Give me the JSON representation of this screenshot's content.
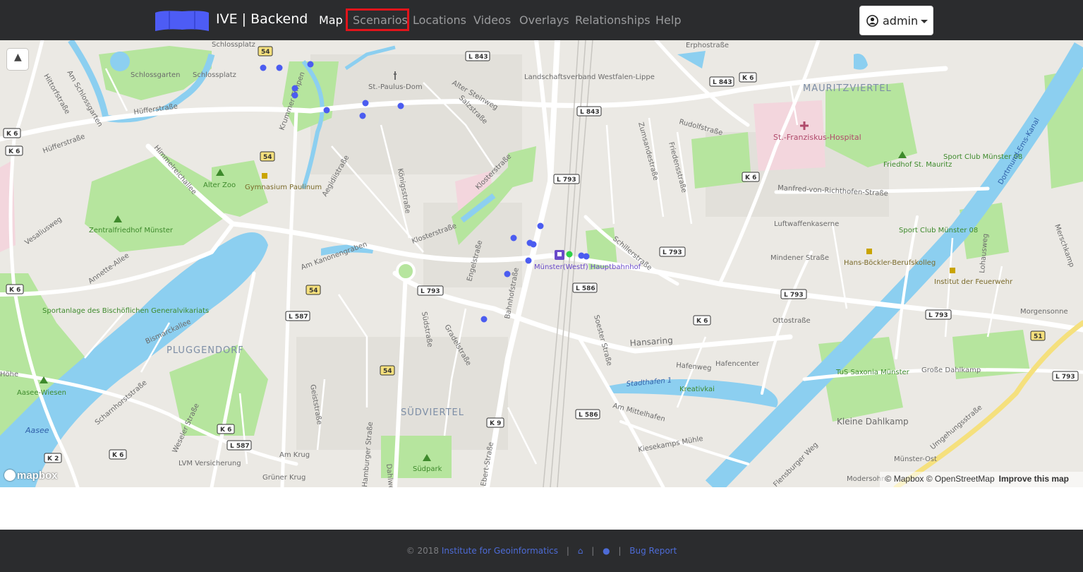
{
  "app": {
    "brand": "IVE | Backend"
  },
  "nav": {
    "items": [
      {
        "label": "Map",
        "active": true
      },
      {
        "label": "Scenarios",
        "highlighted": true
      },
      {
        "label": "Locations"
      },
      {
        "label": "Videos"
      },
      {
        "label": "Overlays"
      },
      {
        "label": "Relationships"
      },
      {
        "label": "Help"
      }
    ],
    "user": {
      "label": "admin",
      "icon": "user-circle-icon"
    }
  },
  "map": {
    "compass_icon": "compass-icon",
    "attribution": "© Mapbox © OpenStreetMap",
    "improve_link": "Improve this map",
    "provider_logo": "mapbox",
    "labels": [
      "Schlossplatz",
      "Schlossgarten",
      "Schlossplatz",
      "Am Schlossgarten",
      "Hittorfstraße",
      "Hüfferstraße",
      "Hüfferstraße",
      "Himmelreichallee",
      "Alter Zoo",
      "Gymnasium Paulinum",
      "Zentralfriedhof Münster",
      "Vesaliusweg",
      "Annette-Allee",
      "Am Kanonengraben",
      "Aegidiistraße",
      "Krummer Timpen",
      "St.-Paulus-Dom",
      "Königsstraße",
      "Klosterstraße",
      "Klosterstraße",
      "Alter Steinweg",
      "Salzstraße",
      "Landschaftsverband Westfalen-Lippe",
      "Erphostraße",
      "MAURITZVIERTEL",
      "St.-Franziskus-Hospital",
      "Rudolfstraße",
      "Zumsandestraße",
      "Friedensstraße",
      "Friedhof St. Mauritz",
      "Sport Club Münster 08",
      "Dortmund-Ems-Kanal",
      "Manfred-von-Richthofen-Straße",
      "Luftwaffenkaserne",
      "Sport Club Münster 08",
      "Mindener Straße",
      "Hans-Böckler-Berufskolleg",
      "Institut der Feuerwehr",
      "Lohausweg",
      "Merschkamp",
      "Morgensonne",
      "Schillerstraße",
      "Münster(Westf) Hauptbahnhof",
      "Engelstraße",
      "Bahnhofstraße",
      "Ottostraße",
      "Hansaring",
      "Soester Straße",
      "Hafenweg",
      "Hafencenter",
      "Kreativkai",
      "Stadthafen 1",
      "Am Mittelhafen",
      "Kiesekamps Mühle",
      "TuS Saxonia Münster",
      "Große Dahlkamp",
      "Kleine Dahlkamp",
      "Umgehungsstraße",
      "Münster-Ost",
      "Modersohn",
      "Sportanlage des Bischöflichen Generalvikariats",
      "Bismarckallee",
      "PLUGGENDORF",
      "Aasee-Wiesen",
      "Aasee",
      "Scharnhorststraße",
      "Weseler Straße",
      "Geiststraße",
      "SÜDVIERTEL",
      "Südstraße",
      "Gradelstraße",
      "Am Krug",
      "LVM Versicherung",
      "Grüner Krug",
      "Südpark",
      "Hamburger Straße",
      "Ebert-Straße",
      "Dahlweg",
      "Flensburger Weg",
      "Höhe"
    ],
    "road_shields": [
      "54",
      "L 843",
      "L 843",
      "L 843",
      "K 6",
      "K 6",
      "K 6",
      "54",
      "L 793",
      "L 793",
      "L 793",
      "L 793",
      "L 793",
      "K 6",
      "54",
      "L 587",
      "L 586",
      "L 586",
      "K 6",
      "K 6",
      "K 6",
      "L 587",
      "K 9",
      "K 2",
      "54",
      "51",
      "L 793",
      "K 6"
    ],
    "marker_colors": {
      "blue": "#4b5cf0",
      "green": "#2fd047"
    },
    "colors": {
      "land": "#ebe9e4",
      "park": "#b6e59e",
      "water": "#8ccff0",
      "road": "#ffffff",
      "motorway": "#f5e07d",
      "hospital": "#f3d6dd",
      "district": "#7d8ea6"
    }
  },
  "footer": {
    "copyright": "© 2018",
    "institute": "Institute for Geoinformatics",
    "home_icon": "home-icon",
    "github_icon": "github-icon",
    "bug_report": "Bug Report",
    "separator": "|"
  }
}
